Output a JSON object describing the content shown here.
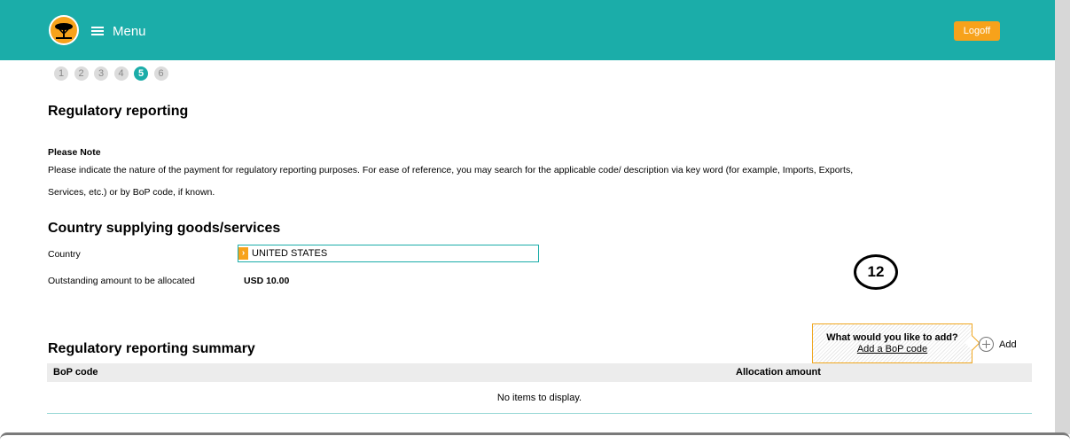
{
  "header": {
    "menu_label": "Menu",
    "logoff_label": "Logoff"
  },
  "steps": [
    "1",
    "2",
    "3",
    "4",
    "5",
    "6"
  ],
  "active_step": "5",
  "page": {
    "title": "Regulatory reporting",
    "note_title": "Please Note",
    "note_line1": "Please indicate the nature of the payment for regulatory reporting purposes. For ease of reference, you may search for the applicable code/ description via key word (for example, Imports, Exports,",
    "note_line2": "Services, etc.) or by BoP code, if known."
  },
  "country_section": {
    "title": "Country supplying goods/services",
    "country_label": "Country",
    "country_value": "UNITED STATES",
    "outstanding_label": "Outstanding amount to be allocated",
    "outstanding_value": "USD 10.00"
  },
  "marker": "12",
  "add_popup": {
    "question": "What would you like to add?",
    "link": "Add a BoP code",
    "add_label": "Add"
  },
  "summary": {
    "title": "Regulatory reporting summary",
    "col_bop": "BoP code",
    "col_amount": "Allocation amount",
    "empty_text": "No items to display."
  },
  "colors": {
    "teal": "#1bada9",
    "orange": "#f7a21b"
  }
}
